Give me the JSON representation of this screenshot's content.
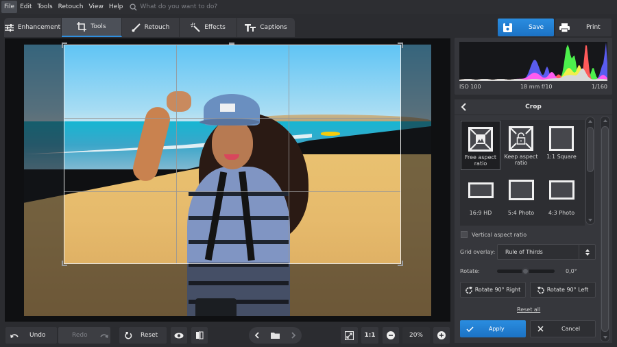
{
  "menu": {
    "items": [
      "File",
      "Edit",
      "Tools",
      "Retouch",
      "View",
      "Help"
    ],
    "active_index": 0,
    "search_placeholder": "What do you want to do?"
  },
  "tabs": [
    {
      "label": "Enhancement",
      "icon": "sliders-icon"
    },
    {
      "label": "Tools",
      "icon": "crop-icon",
      "active": true
    },
    {
      "label": "Retouch",
      "icon": "brush-icon"
    },
    {
      "label": "Effects",
      "icon": "magic-wand-icon"
    },
    {
      "label": "Captions",
      "icon": "text-icon"
    }
  ],
  "header_actions": {
    "save_label": "Save",
    "print_label": "Print"
  },
  "histogram": {
    "iso": "ISO 100",
    "lens": "18 mm f/10",
    "shutter": "1/160",
    "colors": {
      "blue": "#5a5cf0",
      "magenta": "#ff5cf0",
      "red": "#ff5a5a",
      "green": "#4cf04c",
      "yellow": "#f0f04c",
      "gray": "#d8d8d8"
    }
  },
  "crop_panel": {
    "title": "Crop",
    "presets": [
      {
        "label": "Free aspect ratio",
        "line1": "Free aspect",
        "line2": "ratio",
        "selected": true
      },
      {
        "label": "Keep aspect ratio",
        "line1": "Keep aspect",
        "line2": "ratio"
      },
      {
        "label": "1:1 Square",
        "line1": "",
        "line2": "1:1 Square"
      },
      {
        "label": "16:9 HD",
        "line1": "",
        "line2": "16:9 HD"
      },
      {
        "label": "5:4 Photo",
        "line1": "",
        "line2": "5:4 Photo"
      },
      {
        "label": "4:3 Photo",
        "line1": "",
        "line2": "4:3 Photo"
      }
    ],
    "vertical_aspect_label": "Vertical aspect ratio",
    "vertical_aspect_checked": false,
    "grid_overlay_label": "Grid overlay:",
    "grid_overlay_value": "Rule of Thirds",
    "rotate_label": "Rotate:",
    "rotate_value": "0,0°",
    "rotate_fraction": 0.5,
    "rotate_right_label": "Rotate 90° Right",
    "rotate_left_label": "Rotate 90° Left",
    "reset_all_label": "Reset all",
    "apply_label": "Apply",
    "cancel_label": "Cancel"
  },
  "bottom_toolbar": {
    "undo_label": "Undo",
    "redo_label": "Redo",
    "reset_label": "Reset",
    "fit_label": "1:1",
    "zoom_value": "20%"
  },
  "accent_color": "#2389de"
}
